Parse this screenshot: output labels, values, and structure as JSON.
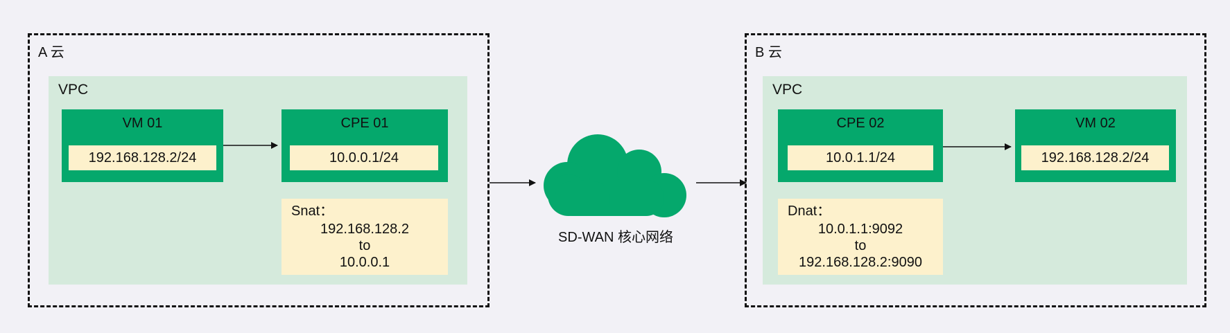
{
  "cloud_a": {
    "label": "A 云",
    "vpc_label": "VPC",
    "vm": {
      "title": "VM 01",
      "ip": "192.168.128.2/24"
    },
    "cpe": {
      "title": "CPE 01",
      "ip": "10.0.0.1/24"
    },
    "nat": {
      "title": "Snat：",
      "line1": "192.168.128.2",
      "line2": "to",
      "line3": "10.0.0.1"
    }
  },
  "core": {
    "label": "SD-WAN 核心网络",
    "icon": "cloud-icon"
  },
  "cloud_b": {
    "label": "B 云",
    "vpc_label": "VPC",
    "cpe": {
      "title": "CPE 02",
      "ip": "10.0.1.1/24"
    },
    "vm": {
      "title": "VM 02",
      "ip": "192.168.128.2/24"
    },
    "nat": {
      "title": "Dnat：",
      "line1": "10.0.1.1:9092",
      "line2": "to",
      "line3": "192.168.128.2:9090"
    }
  },
  "colors": {
    "background": "#f2f1f6",
    "node": "#05a86c",
    "vpc": "#d5eadc",
    "ip_box": "#fdf1cc"
  }
}
